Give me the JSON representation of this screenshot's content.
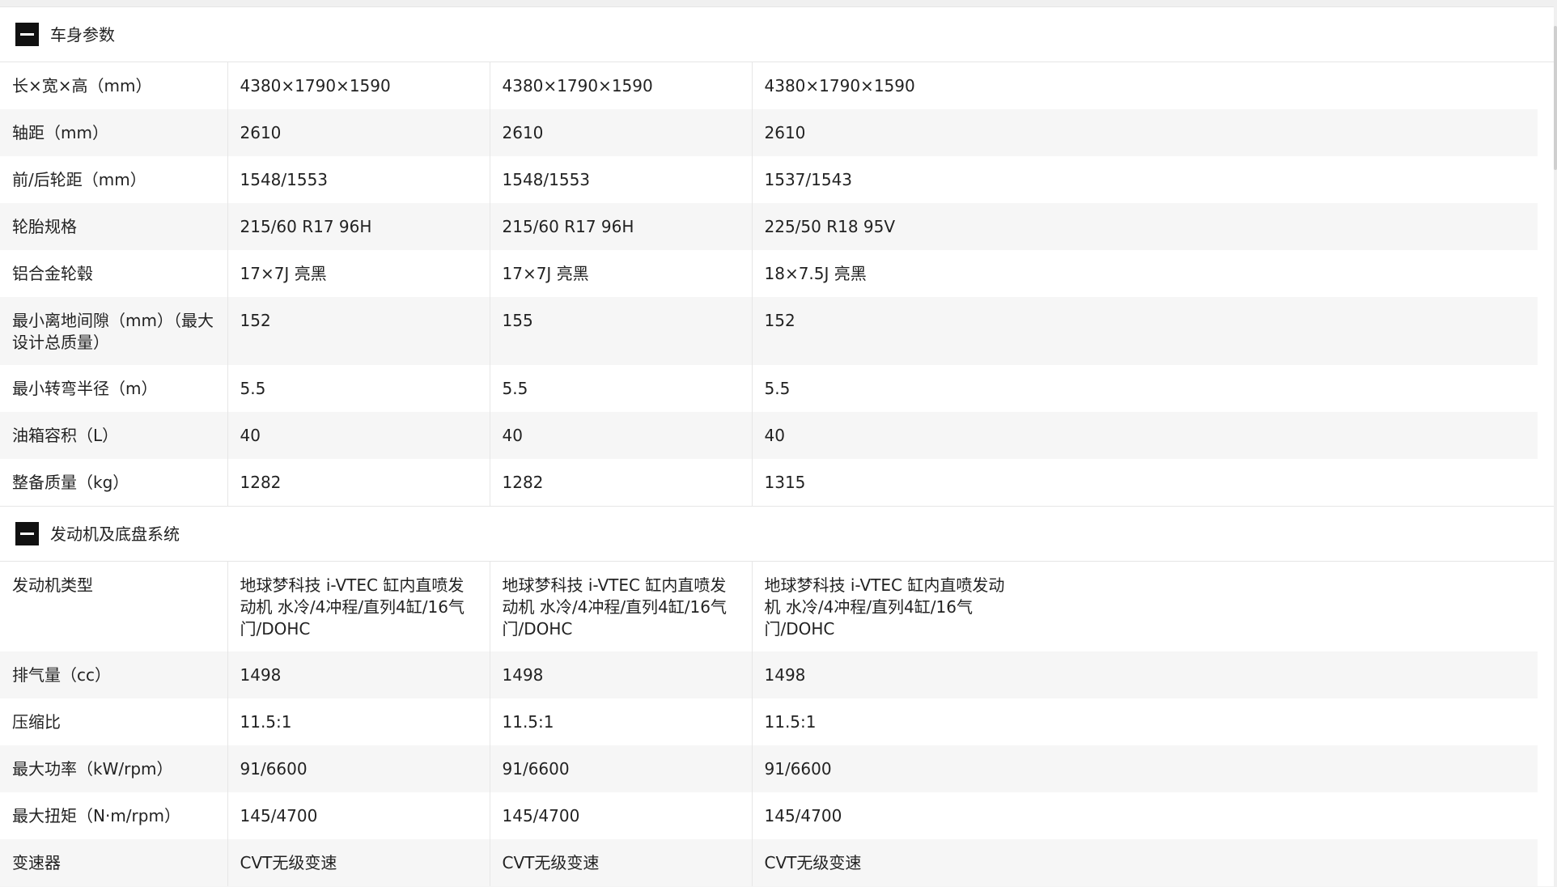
{
  "sections": [
    {
      "title": "车身参数",
      "rows": [
        {
          "label": "长×宽×高（mm）",
          "values": [
            "4380×1790×1590",
            "4380×1790×1590",
            "4380×1790×1590"
          ]
        },
        {
          "label": "轴距（mm）",
          "values": [
            "2610",
            "2610",
            "2610"
          ]
        },
        {
          "label": "前/后轮距（mm）",
          "values": [
            "1548/1553",
            "1548/1553",
            "1537/1543"
          ]
        },
        {
          "label": "轮胎规格",
          "values": [
            "215/60 R17 96H",
            "215/60 R17 96H",
            "225/50 R18 95V"
          ]
        },
        {
          "label": "铝合金轮毂",
          "values": [
            "17×7J 亮黑",
            "17×7J 亮黑",
            "18×7.5J 亮黑"
          ]
        },
        {
          "label": "最小离地间隙（mm）（最大设计总质量）",
          "values": [
            "152",
            "155",
            "152"
          ]
        },
        {
          "label": "最小转弯半径（m）",
          "values": [
            "5.5",
            "5.5",
            "5.5"
          ]
        },
        {
          "label": "油箱容积（L）",
          "values": [
            "40",
            "40",
            "40"
          ]
        },
        {
          "label": "整备质量（kg）",
          "values": [
            "1282",
            "1282",
            "1315"
          ]
        }
      ]
    },
    {
      "title": "发动机及底盘系统",
      "rows": [
        {
          "label": "发动机类型",
          "values": [
            "地球梦科技 i-VTEC 缸内直喷发动机 水冷/4冲程/直列4缸/16气门/DOHC",
            "地球梦科技 i-VTEC 缸内直喷发动机 水冷/4冲程/直列4缸/16气门/DOHC",
            "地球梦科技 i-VTEC 缸内直喷发动机 水冷/4冲程/直列4缸/16气门/DOHC"
          ]
        },
        {
          "label": "排气量（cc）",
          "values": [
            "1498",
            "1498",
            "1498"
          ]
        },
        {
          "label": "压缩比",
          "values": [
            "11.5:1",
            "11.5:1",
            "11.5:1"
          ]
        },
        {
          "label": "最大功率（kW/rpm）",
          "values": [
            "91/6600",
            "91/6600",
            "91/6600"
          ]
        },
        {
          "label": "最大扭矩（N·m/rpm）",
          "values": [
            "145/4700",
            "145/4700",
            "145/4700"
          ]
        },
        {
          "label": "变速器",
          "values": [
            "CVT无级变速",
            "CVT无级变速",
            "CVT无级变速"
          ]
        }
      ]
    }
  ],
  "icons": {
    "collapse": "collapse-minus-icon"
  }
}
